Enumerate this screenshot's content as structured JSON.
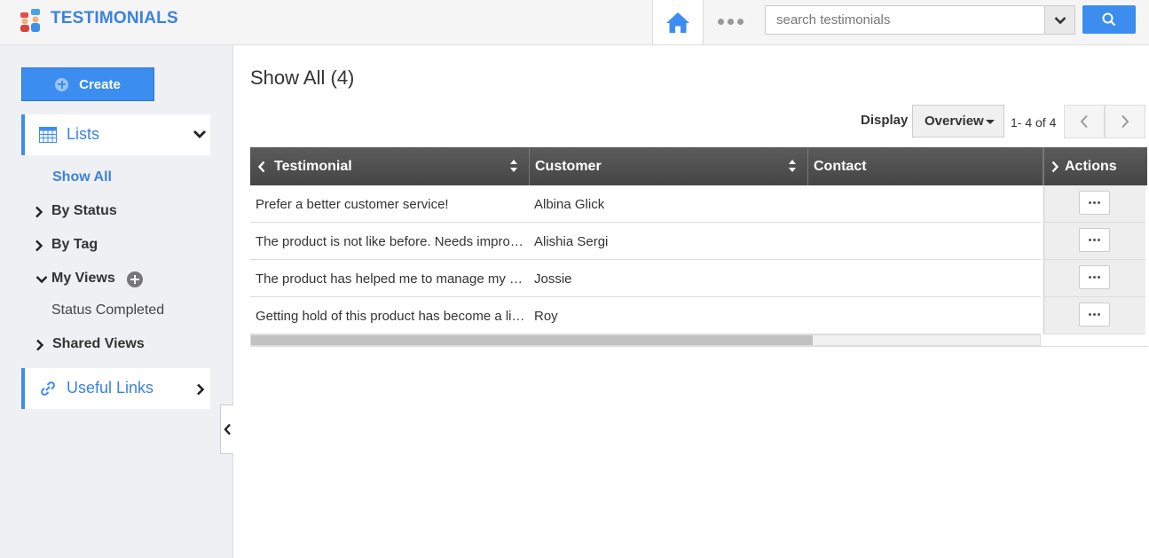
{
  "header": {
    "app_title": "TESTIMONIALS",
    "search_placeholder": "search testimonials"
  },
  "sidebar": {
    "create_label": "Create",
    "lists_label": "Lists",
    "items": [
      {
        "label": "Show All"
      },
      {
        "label": "By Status"
      },
      {
        "label": "By Tag"
      },
      {
        "label": "My Views"
      },
      {
        "label": "Status Completed"
      },
      {
        "label": "Shared Views"
      }
    ],
    "useful_links_label": "Useful Links"
  },
  "main": {
    "title": "Show All (4)",
    "display_label": "Display",
    "display_value": "Overview",
    "pager_text": "1- 4 of 4",
    "columns": [
      "Testimonial",
      "Customer",
      "Contact",
      "Actions"
    ],
    "rows": [
      {
        "testimonial": "Prefer a better customer service!",
        "customer": "Albina Glick",
        "contact": ""
      },
      {
        "testimonial": "The product is not like before. Needs improvement",
        "customer": "Alishia Sergi",
        "contact": ""
      },
      {
        "testimonial": "The product has helped me to manage my business",
        "customer": "Jossie",
        "contact": ""
      },
      {
        "testimonial": "Getting hold of this product has become a little difficult",
        "customer": "Roy",
        "contact": ""
      }
    ]
  },
  "colors": {
    "accent": "#3b8def",
    "header_bg": "#4f4f4f",
    "sidebar_bg": "#eef0f3"
  }
}
